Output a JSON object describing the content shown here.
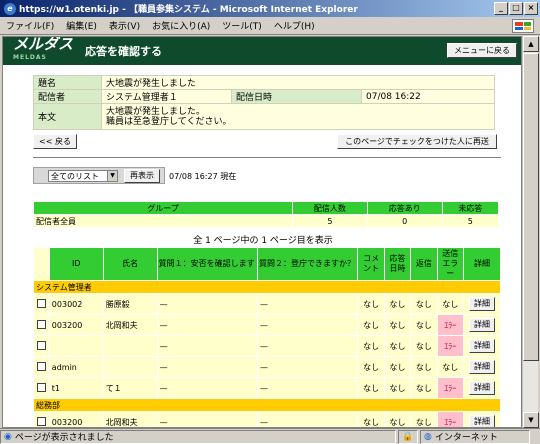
{
  "window": {
    "title": "https://w1.otenki.jp - 【職員参集システム - Microsoft Internet Explorer"
  },
  "menubar": [
    "ファイル(F)",
    "編集(E)",
    "表示(V)",
    "お気に入り(A)",
    "ツール(T)",
    "ヘルプ(H)"
  ],
  "app": {
    "logo": "メルダス",
    "logo_sub": "MELDAS",
    "page_title": "応答を確認する",
    "menu_button": "メニューに戻る"
  },
  "message": {
    "subject_label": "題名",
    "subject": "大地震が発生しました",
    "sender_label": "配信者",
    "sender": "システム管理者１",
    "date_label": "配信日時",
    "date": "07/08 16:22",
    "body_label": "本文",
    "body_line1": "大地震が発生しました。",
    "body_line2": "職員は至急登庁してください。"
  },
  "actions": {
    "back": "<< 戻る",
    "resend": "このページでチェックをつけた人に再送"
  },
  "filter": {
    "selected": "全てのリスト",
    "redisplay": "再表示",
    "timestamp": "07/08 16:27 現在"
  },
  "summary": {
    "headers": [
      "グループ",
      "配信人数",
      "応答あり",
      "未応答"
    ],
    "row": [
      "配信者全員",
      "5",
      "0",
      "5"
    ]
  },
  "pageinfo": "全 1 ページ中の 1 ページ目を表示",
  "table": {
    "headers": [
      "ID",
      "氏名",
      "質問１：安否を確認します",
      "質問２：登庁できますか？",
      "コメント",
      "応答日時",
      "返信",
      "送信エラー",
      "詳細"
    ],
    "group1": "システム管理者",
    "group2": "総務部",
    "rows": [
      {
        "id": "003002",
        "name": "勝原毅",
        "q1": "—",
        "q2": "—",
        "comment": "なし",
        "date": "なし",
        "reply": "なし",
        "error": "なし"
      },
      {
        "id": "003200",
        "name": "北岡和夫",
        "q1": "—",
        "q2": "—",
        "comment": "なし",
        "date": "なし",
        "reply": "なし",
        "error": "ｴﾗｰ"
      },
      {
        "id": "",
        "name": "",
        "q1": "—",
        "q2": "—",
        "comment": "なし",
        "date": "なし",
        "reply": "なし",
        "error": "ｴﾗｰ"
      },
      {
        "id": "admin",
        "name": "",
        "q1": "—",
        "q2": "—",
        "comment": "なし",
        "date": "なし",
        "reply": "なし",
        "error": "なし"
      },
      {
        "id": "t1",
        "name": "て１",
        "q1": "—",
        "q2": "—",
        "comment": "なし",
        "date": "なし",
        "reply": "なし",
        "error": "ｴﾗｰ"
      },
      {
        "id": "003200",
        "name": "北岡和夫",
        "q1": "—",
        "q2": "—",
        "comment": "なし",
        "date": "なし",
        "reply": "なし",
        "error": "ｴﾗｰ"
      }
    ],
    "detail": "詳細"
  },
  "status": {
    "text": "ページが表示されました",
    "zone": "インターネット"
  }
}
